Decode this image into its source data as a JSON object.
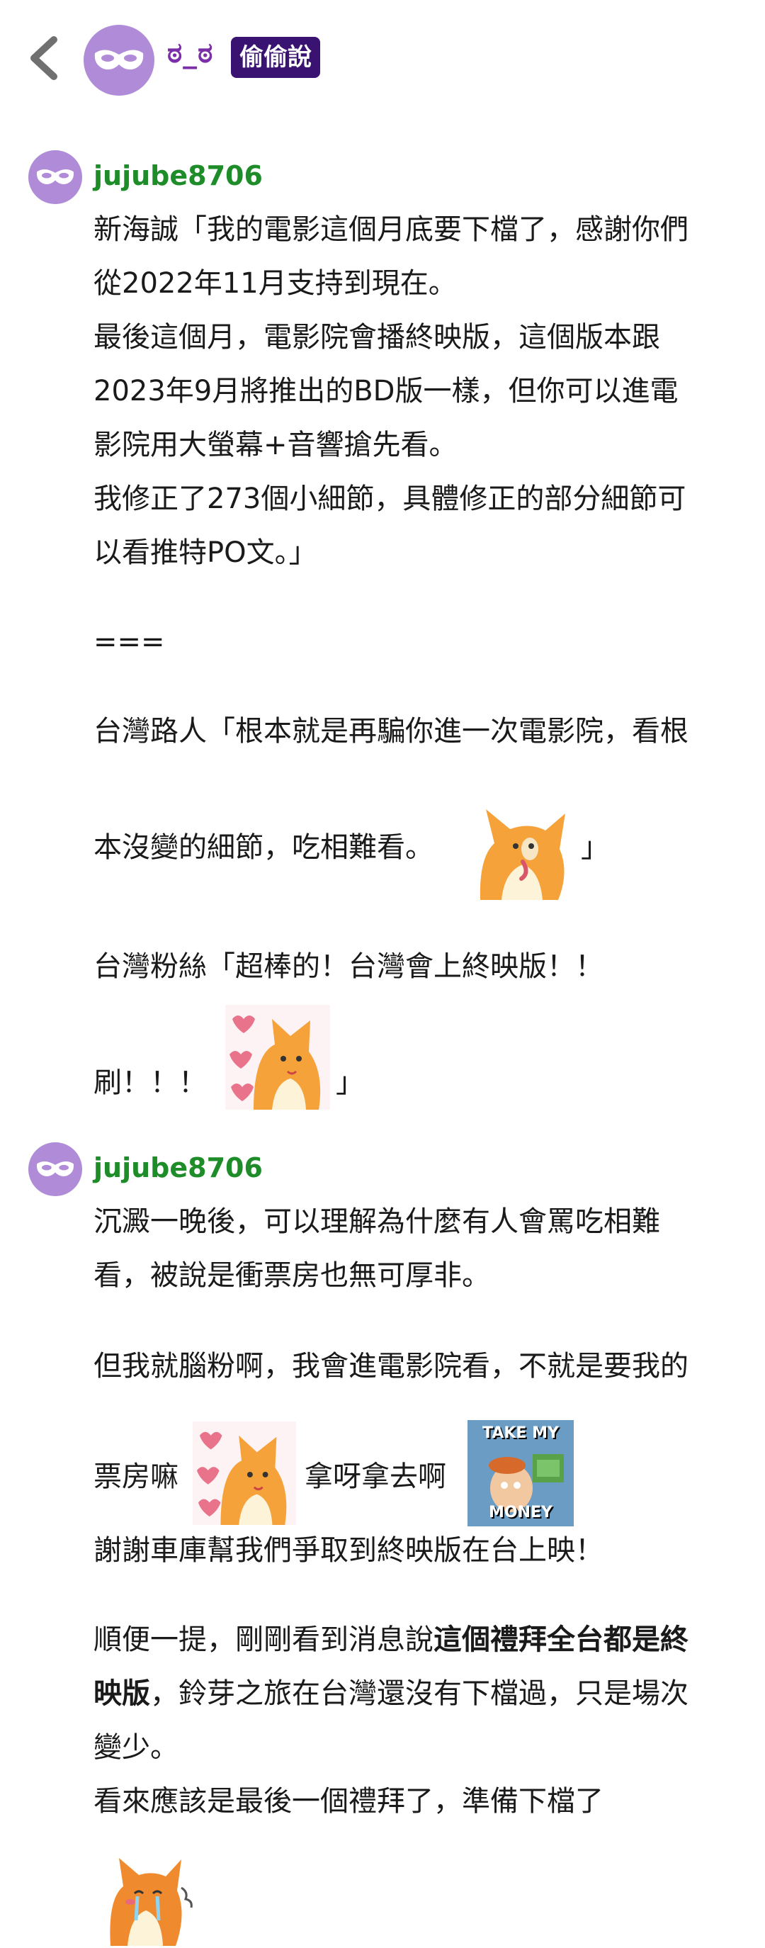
{
  "header": {
    "nickname": "ಠ_ಠ",
    "badge": "偷偷說"
  },
  "comments": [
    {
      "author": "jujube8706",
      "lines": [
        "新海誠「我的電影這個月底要下檔了，感謝你們",
        "從2022年11月支持到現在。",
        "最後這個月，電影院會播終映版，這個版本跟",
        "2023年9月將推出的BD版一樣，但你可以進電",
        "影院用大螢幕+音響搶先看。",
        "我修正了273個小細節，具體修正的部分細節可",
        "以看推特PO文。」",
        "===",
        "台灣路人「根本就是再騙你進一次電影院，看根",
        "本沒變的細節，吃相難看。",
        "」",
        "台灣粉絲「超棒的！台灣會上終映版！！",
        "刷！！！",
        "」"
      ]
    },
    {
      "author": "jujube8706",
      "lines": [
        "沉澱一晚後，可以理解為什麼有人會罵吃相難",
        "看，被說是衝票房也無可厚非。",
        "但我就腦粉啊，我會進電影院看，不就是要我的",
        "票房嘛",
        "拿呀拿去啊",
        "謝謝車庫幫我們爭取到終映版在台上映！",
        "順便一提，剛剛看到消息說",
        "這個禮拜全台都是終",
        "映版",
        "，鈴芽之旅在台灣還沒有下檔過，只是場次",
        "變少。",
        "看來應該是最後一個禮拜了，準備下檔了"
      ],
      "sticker_text": [
        "TAKE MY",
        "MONEY"
      ]
    }
  ],
  "colors": {
    "mask_avatar": "#b08cd8",
    "author": "#1e8c28",
    "badge_bg": "#3a1372",
    "nickname": "#7a2ea8"
  },
  "icons": {
    "back": "chevron-left-icon",
    "avatar": "mask-icon"
  }
}
